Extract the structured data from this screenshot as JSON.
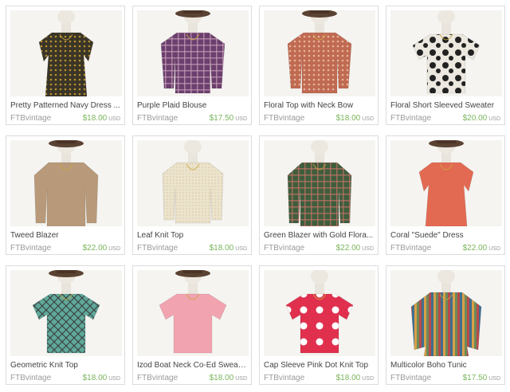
{
  "listings": [
    {
      "title": "Pretty Patterned Navy Dress ...",
      "shop": "FTBvintage",
      "price": "$18.00",
      "currency": "USD",
      "garment": "dress",
      "color": "#3a3527",
      "accent": "#b8902e",
      "hat": false,
      "pattern": "dots"
    },
    {
      "title": "Purple Plaid Blouse",
      "shop": "FTBvintage",
      "price": "$17.50",
      "currency": "USD",
      "garment": "blouse",
      "color": "#6b3f6e",
      "accent": "#c9a0b8",
      "hat": true,
      "pattern": "plaid"
    },
    {
      "title": "Floral Top with Neck Bow",
      "shop": "FTBvintage",
      "price": "$18.00",
      "currency": "USD",
      "garment": "blouse",
      "color": "#c06a52",
      "accent": "#e8b49c",
      "hat": true,
      "pattern": "dots"
    },
    {
      "title": "Floral Short Sleeved Sweater",
      "shop": "FTBvintage",
      "price": "$20.00",
      "currency": "USD",
      "garment": "sweater",
      "color": "#ece8e0",
      "accent": "#222222",
      "hat": false,
      "pattern": "floral"
    },
    {
      "title": "Tweed Blazer",
      "shop": "FTBvintage",
      "price": "$22.00",
      "currency": "USD",
      "garment": "blazer",
      "color": "#b89a7a",
      "accent": "#e2664e",
      "hat": true,
      "pattern": "none"
    },
    {
      "title": "Leaf Knit Top",
      "shop": "FTBvintage",
      "price": "$18.00",
      "currency": "USD",
      "garment": "cardigan",
      "color": "#ece3cc",
      "accent": "#d8c9a6",
      "hat": false,
      "pattern": "knit"
    },
    {
      "title": "Green Blazer with Gold Flora...",
      "shop": "FTBvintage",
      "price": "$22.00",
      "currency": "USD",
      "garment": "blazer",
      "color": "#3f5d3c",
      "accent": "#c8746a",
      "hat": false,
      "pattern": "plaid"
    },
    {
      "title": "Coral \"Suede\" Dress",
      "shop": "FTBvintage",
      "price": "$22.00",
      "currency": "USD",
      "garment": "dress",
      "color": "#e36a52",
      "accent": "#7a4a2a",
      "hat": true,
      "pattern": "none"
    },
    {
      "title": "Geometric Knit Top",
      "shop": "FTBvintage",
      "price": "$18.00",
      "currency": "USD",
      "garment": "sweater",
      "color": "#5fa89a",
      "accent": "#3a3a3a",
      "hat": true,
      "pattern": "geo"
    },
    {
      "title": "Izod Boat Neck Co-Ed Sweater",
      "shop": "FTBvintage",
      "price": "$18.00",
      "currency": "USD",
      "garment": "sweater",
      "color": "#f2a3b0",
      "accent": "#f7c5cd",
      "hat": true,
      "pattern": "none"
    },
    {
      "title": "Cap Sleeve Pink Dot Knit Top",
      "shop": "FTBvintage",
      "price": "$18.00",
      "currency": "USD",
      "garment": "sweater",
      "color": "#e0304e",
      "accent": "#ffffff",
      "hat": false,
      "pattern": "bigdots"
    },
    {
      "title": "Multicolor Boho Tunic",
      "shop": "FTBvintage",
      "price": "$17.50",
      "currency": "USD",
      "garment": "tunic",
      "color": "#b84a4a",
      "accent": "#d8c09a",
      "hat": false,
      "pattern": "stripes"
    }
  ]
}
